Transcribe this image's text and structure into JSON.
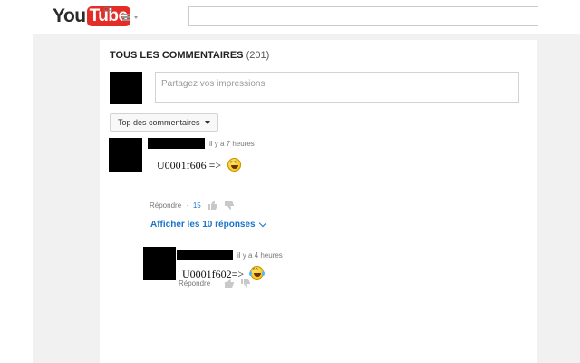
{
  "masthead": {
    "logo_you": "You",
    "logo_tube": "Tube",
    "logo_region": "FR",
    "search_placeholder": ""
  },
  "comments": {
    "header_title": "Tous les commentaires",
    "header_count": "(201)",
    "share_placeholder": "Partagez vos impressions",
    "sort_label": "Top des commentaires",
    "show_replies_label": "Afficher les 10 réponses"
  },
  "comment": {
    "timestamp": "il y a 7 heures",
    "text": "U0001f606 =>",
    "emoji": "laughing-emoji",
    "reply_label": "Répondre",
    "like_count": "15"
  },
  "reply": {
    "timestamp": "il y a 4 heures",
    "text": "U0001f602=>",
    "emoji": "tears-of-joy-emoji",
    "reply_label": "Répondre"
  },
  "colors": {
    "brand_red": "#e52d27",
    "link_blue": "#1a73c8",
    "page_bg": "#f1f1f1"
  }
}
